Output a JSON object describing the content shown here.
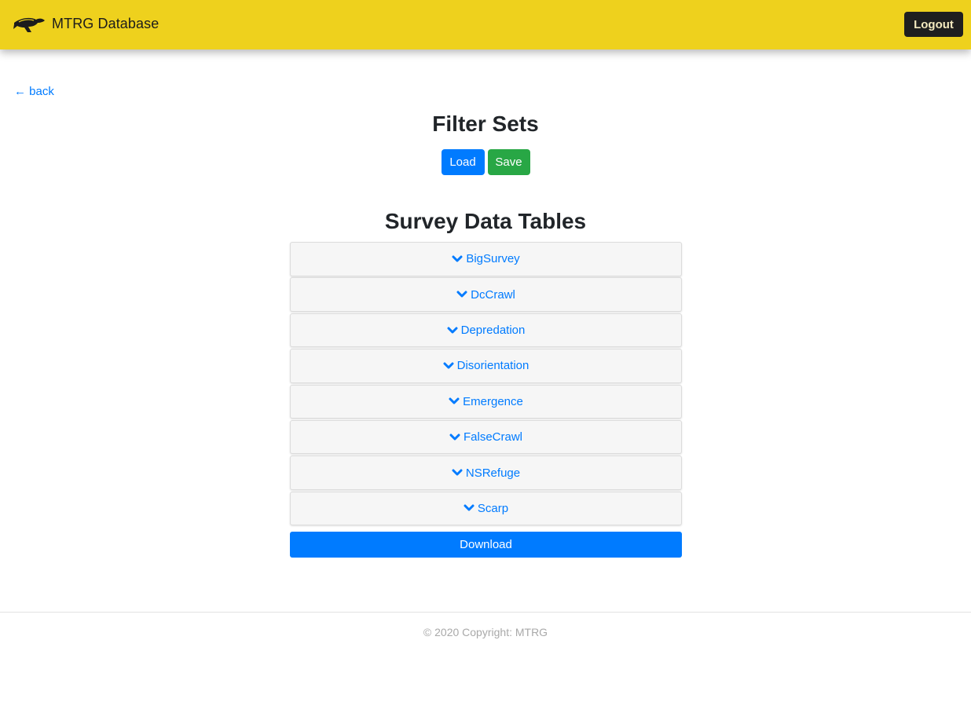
{
  "navbar": {
    "brand": "MTRG Database",
    "logo_icon": "sea-turtle-icon",
    "logout_label": "Logout",
    "background": "#eed11d"
  },
  "back_link": "← back",
  "filter_sets": {
    "title": "Filter Sets",
    "load_label": "Load",
    "save_label": "Save"
  },
  "survey_tables": {
    "title": "Survey Data Tables",
    "chevron_icon": "chevron-down-icon",
    "items": [
      {
        "label": "BigSurvey"
      },
      {
        "label": "DcCrawl"
      },
      {
        "label": "Depredation"
      },
      {
        "label": "Disorientation"
      },
      {
        "label": "Emergence"
      },
      {
        "label": "FalseCrawl"
      },
      {
        "label": "NSRefuge"
      },
      {
        "label": "Scarp"
      }
    ]
  },
  "download_label": "Download",
  "footer": {
    "copyright": "© 2020 Copyright: MTRG"
  },
  "colors": {
    "primary": "#007bff",
    "success": "#28a745",
    "dark": "#1f1f1f"
  }
}
